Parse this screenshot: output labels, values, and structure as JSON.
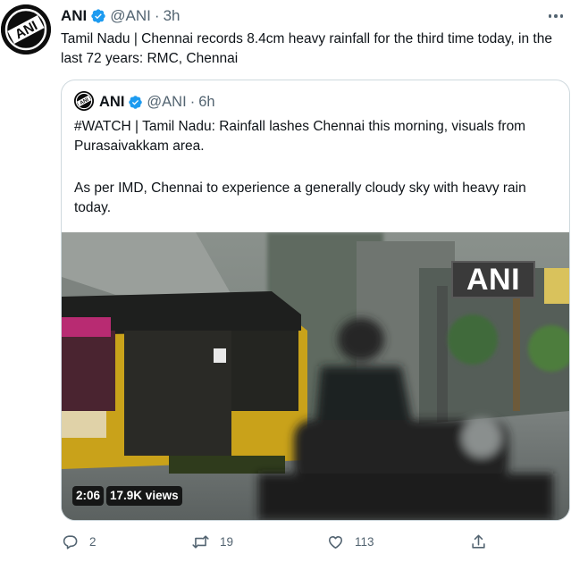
{
  "tweet": {
    "author_name": "ANI",
    "handle": "@ANI",
    "separator": "·",
    "time": "3h",
    "text": "Tamil Nadu | Chennai records 8.4cm heavy rainfall for the third time today, in the last 72 years: RMC, Chennai",
    "avatar_text": "ANI"
  },
  "quote": {
    "author_name": "ANI",
    "handle": "@ANI",
    "separator": "·",
    "time": "6h",
    "text_line1": "#WATCH | Tamil Nadu: Rainfall lashes Chennai this morning, visuals from Purasaivakkam area.",
    "text_line2": "As per IMD, Chennai to experience a generally cloudy sky with heavy rain today.",
    "media": {
      "watermark": "ANI",
      "duration": "2:06",
      "views": "17.9K views"
    }
  },
  "actions": {
    "reply_count": "2",
    "retweet_count": "19",
    "like_count": "113"
  },
  "colors": {
    "text_primary": "#0f1419",
    "text_secondary": "#536471",
    "verified": "#1d9bf0",
    "border": "#cfd9de"
  },
  "icons": {
    "verified": "verified-badge-icon",
    "reply": "reply-icon",
    "retweet": "retweet-icon",
    "like": "heart-icon",
    "share": "share-icon",
    "more": "more-icon"
  }
}
